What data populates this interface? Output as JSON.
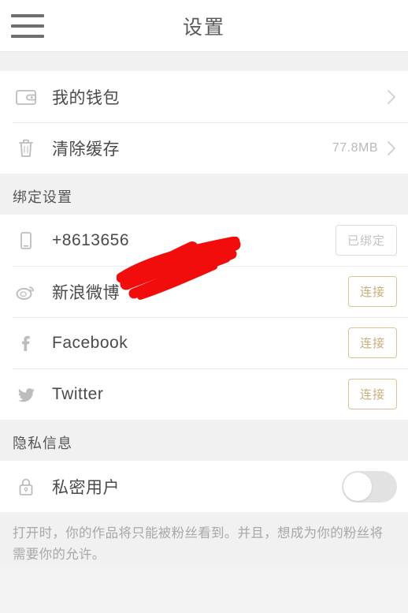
{
  "header": {
    "title": "设置",
    "menu_icon": "hamburger-menu-icon"
  },
  "sections": [
    {
      "id": "general",
      "label": "",
      "rows": [
        {
          "id": "wallet",
          "icon": "wallet-icon",
          "label": "我的钱包",
          "value": "",
          "accessory": "chevron"
        },
        {
          "id": "clearcache",
          "icon": "trash-icon",
          "label": "清除缓存",
          "value": "77.8MB",
          "accessory": "chevron"
        }
      ]
    },
    {
      "id": "binding",
      "label": "绑定设置",
      "rows": [
        {
          "id": "phone",
          "icon": "phone-icon",
          "label": "+8613656",
          "redacted": true,
          "accessory": "button",
          "button_label": "已绑定",
          "button_state": "bound"
        },
        {
          "id": "weibo",
          "icon": "weibo-icon",
          "label": "新浪微博",
          "accessory": "button",
          "button_label": "连接",
          "button_state": "connect"
        },
        {
          "id": "facebook",
          "icon": "facebook-icon",
          "label": "Facebook",
          "accessory": "button",
          "button_label": "连接",
          "button_state": "connect"
        },
        {
          "id": "twitter",
          "icon": "twitter-icon",
          "label": "Twitter",
          "accessory": "button",
          "button_label": "连接",
          "button_state": "connect"
        }
      ]
    },
    {
      "id": "privacy",
      "label": "隐私信息",
      "rows": [
        {
          "id": "private-user",
          "icon": "lock-icon",
          "label": "私密用户",
          "accessory": "toggle",
          "toggle_on": false
        }
      ]
    }
  ],
  "footnote": "打开时，你的作品将只能被粉丝看到。并且，想成为你的粉丝将需要你的允许。",
  "colors": {
    "accent": "#c9ae7c",
    "redaction": "#f20d0d",
    "page_bg": "#f1f1f1",
    "card_bg": "#ffffff",
    "text_primary": "#4a4a4a",
    "text_muted": "#b9b9b9"
  }
}
